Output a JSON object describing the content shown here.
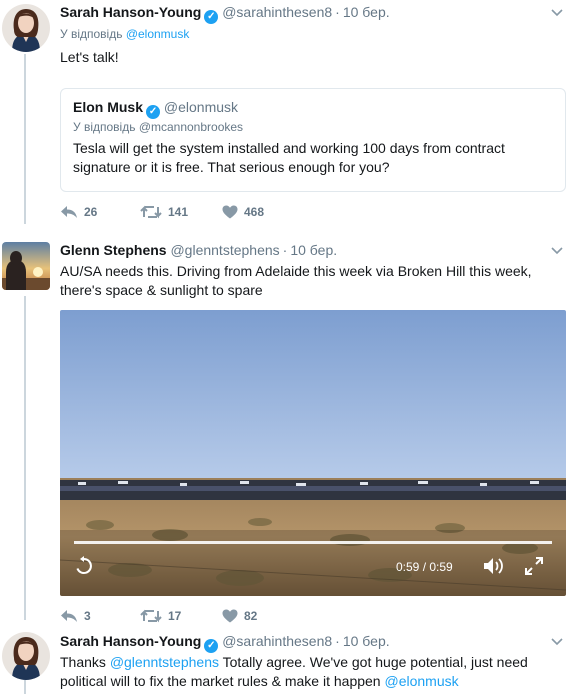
{
  "tweets": [
    {
      "name": "Sarah Hanson-Young",
      "handle": "@sarahinthesen8",
      "time": "10 бер.",
      "reply_prefix": "У відповідь",
      "reply_to": "@elonmusk",
      "text": "Let's talk!",
      "quote": {
        "name": "Elon Musk",
        "handle": "@elonmusk",
        "reply_prefix": "У відповідь",
        "reply_to": "@mcannonbrookes",
        "text": "Tesla will get the system installed and working 100 days from contract signature or it is free. That serious enough for you?"
      },
      "replies": "26",
      "retweets": "141",
      "likes": "468"
    },
    {
      "name": "Glenn Stephens",
      "handle": "@glenntstephens",
      "time": "10 бер.",
      "text": "AU/SA needs this. Driving from Adelaide this week via Broken Hill this week, there's space & sunlight to spare",
      "video": {
        "time_label": "0:59 / 0:59",
        "progress": 1.0
      },
      "replies": "3",
      "retweets": "17",
      "likes": "82"
    },
    {
      "name": "Sarah Hanson-Young",
      "handle": "@sarahinthesen8",
      "time": "10 бер.",
      "text_part1": "Thanks ",
      "mention1": "@glenntstephens",
      "text_part2": " Totally agree. We've got huge potential, just need political will to fix the market rules & make it happen ",
      "mention2": "@elonmusk"
    }
  ],
  "icons": {
    "verified": "verified-badge-icon",
    "caret": "chevron-down-icon",
    "reply": "reply-icon",
    "retweet": "retweet-icon",
    "like": "heart-icon",
    "replay": "replay-icon",
    "volume": "volume-icon",
    "fullscreen": "fullscreen-icon"
  },
  "colors": {
    "link": "#1da1f2",
    "muted": "#657786",
    "verified": "#1da1f2",
    "border": "#e1e8ed"
  }
}
